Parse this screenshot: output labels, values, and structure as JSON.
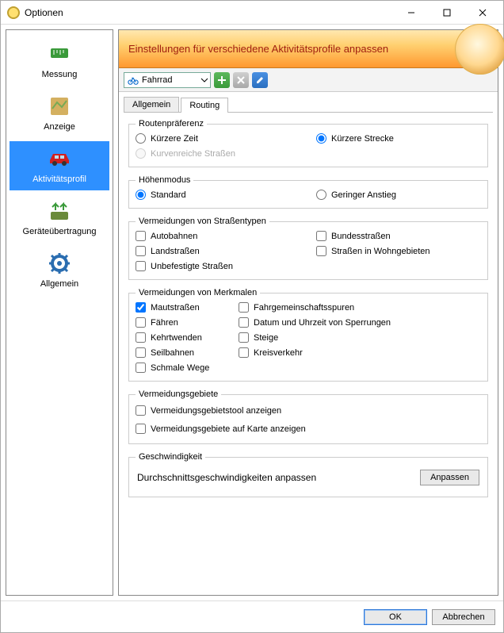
{
  "window": {
    "title": "Optionen"
  },
  "sidebar": {
    "items": [
      {
        "label": "Messung"
      },
      {
        "label": "Anzeige"
      },
      {
        "label": "Aktivitätsprofil"
      },
      {
        "label": "Geräteübertragung"
      },
      {
        "label": "Allgemein"
      }
    ]
  },
  "banner": {
    "title": "Einstellungen für verschiedene Aktivitätsprofile anpassen"
  },
  "profile_selector": {
    "value": "Fahrrad"
  },
  "tabs": [
    {
      "label": "Allgemein"
    },
    {
      "label": "Routing"
    }
  ],
  "groups": {
    "route_pref": {
      "legend": "Routenpräferenz",
      "shorter_time": "Kürzere Zeit",
      "curvy_roads": "Kurvenreiche Straßen",
      "shorter_distance": "Kürzere Strecke"
    },
    "elevation": {
      "legend": "Höhenmodus",
      "standard": "Standard",
      "low_ascent": "Geringer Anstieg"
    },
    "avoid_roads": {
      "legend": "Vermeidungen von Straßentypen",
      "autobahn": "Autobahnen",
      "landstrasse": "Landstraßen",
      "unbefestigt": "Unbefestigte Straßen",
      "bundesstrasse": "Bundesstraßen",
      "wohngebiet": "Straßen in Wohngebieten"
    },
    "avoid_features": {
      "legend": "Vermeidungen von Merkmalen",
      "mautstrassen": "Mautstraßen",
      "faehren": "Fähren",
      "kehrtwenden": "Kehrtwenden",
      "seilbahnen": "Seilbahnen",
      "schmale": "Schmale Wege",
      "fahrgemeinschaft": "Fahrgemeinschaftsspuren",
      "sperrungen": "Datum und Uhrzeit von Sperrungen",
      "steige": "Steige",
      "kreisverkehr": "Kreisverkehr"
    },
    "avoid_areas": {
      "legend": "Vermeidungsgebiete",
      "tool": "Vermeidungsgebietstool anzeigen",
      "on_map": "Vermeidungsgebiete auf Karte anzeigen"
    },
    "speed": {
      "legend": "Geschwindigkeit",
      "desc": "Durchschnittsgeschwindigkeiten anpassen",
      "button": "Anpassen"
    }
  },
  "footer": {
    "ok": "OK",
    "cancel": "Abbrechen"
  },
  "colors": {
    "accent": "#2e90ff",
    "banner_text": "#a02010"
  }
}
